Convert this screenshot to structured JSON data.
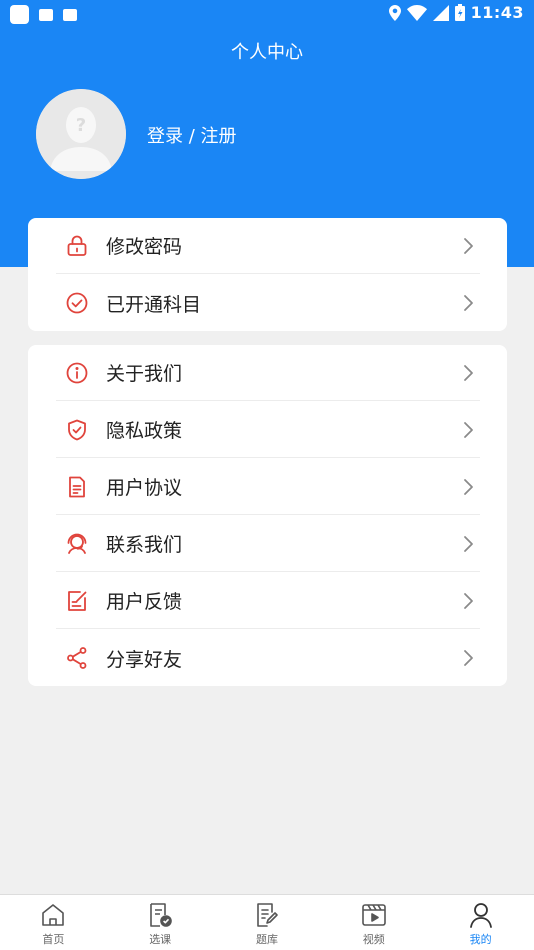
{
  "status_bar": {
    "time": "11:43"
  },
  "header": {
    "title": "个人中心",
    "login_label": "登录 / 注册"
  },
  "colors": {
    "brand": "#1a86f5",
    "icon_accent": "#e0443c",
    "background": "#f0f0f0"
  },
  "card1": {
    "items": [
      {
        "label": "修改密码",
        "icon": "lock-icon"
      },
      {
        "label": "已开通科目",
        "icon": "check-circle-icon"
      }
    ]
  },
  "card2": {
    "items": [
      {
        "label": "关于我们",
        "icon": "info-icon"
      },
      {
        "label": "隐私政策",
        "icon": "shield-icon"
      },
      {
        "label": "用户协议",
        "icon": "document-icon"
      },
      {
        "label": "联系我们",
        "icon": "support-agent-icon"
      },
      {
        "label": "用户反馈",
        "icon": "feedback-icon"
      },
      {
        "label": "分享好友",
        "icon": "share-icon"
      }
    ]
  },
  "tabbar": {
    "tabs": [
      {
        "label": "首页",
        "icon": "home-icon"
      },
      {
        "label": "选课",
        "icon": "course-select-icon"
      },
      {
        "label": "题库",
        "icon": "question-bank-icon"
      },
      {
        "label": "视频",
        "icon": "video-icon"
      },
      {
        "label": "我的",
        "icon": "profile-icon",
        "active": true
      }
    ]
  }
}
